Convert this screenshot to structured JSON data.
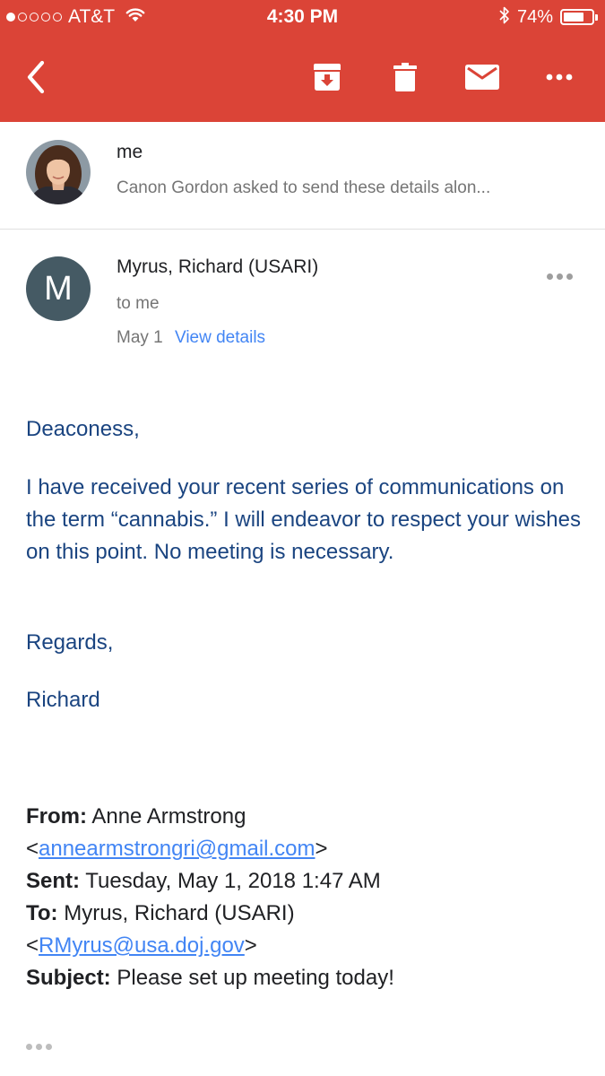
{
  "status_bar": {
    "carrier": "AT&T",
    "time": "4:30 PM",
    "battery_percent": "74%",
    "battery_level": 0.74,
    "signal_bars_filled": 1,
    "signal_bars_total": 5
  },
  "toolbar": {
    "icons": [
      "back-arrow-icon",
      "archive-icon",
      "delete-icon",
      "mark-unread-icon",
      "more-options-icon"
    ],
    "accent_color": "#db4437"
  },
  "collapsed_message": {
    "sender": "me",
    "snippet": "Canon Gordon asked to send these details alon..."
  },
  "message": {
    "avatar_letter": "M",
    "sender": "Myrus, Richard (USARI)",
    "recipient": "to me",
    "date": "May 1",
    "view_details_label": "View details",
    "body": {
      "greeting": "Deaconess,",
      "paragraph": "I have received your recent series of communications on the term “cannabis.” I will endeavor to respect your wishes on this point. No meeting is necessary.",
      "regards": "Regards,",
      "signature": "Richard"
    },
    "quoted": {
      "from_label": "From:",
      "from_name": "Anne Armstrong",
      "from_email": "annearmstrongri@gmail.com",
      "sent_label": "Sent:",
      "sent_value": "Tuesday, May 1, 2018 1:47 AM",
      "to_label": "To:",
      "to_name": "Myrus, Richard (USARI)",
      "to_email": "RMyrus@usa.doj.gov",
      "subject_label": "Subject:",
      "subject_value": "Please set up meeting today!"
    }
  }
}
